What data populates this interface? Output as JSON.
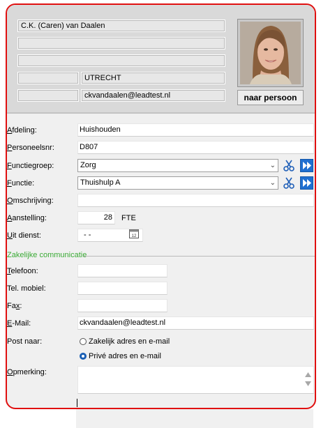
{
  "header": {
    "name": "C.K. (Caren) van Daalen",
    "line2": "",
    "line3": "",
    "postcode": "",
    "city": "UTRECHT",
    "extra": "",
    "email": "ckvandaalen@leadtest.nl",
    "person_button": "naar persoon"
  },
  "labels": {
    "afdeling": {
      "first": "A",
      "rest": "fdeling:"
    },
    "personeelsnr": {
      "first": "P",
      "rest": "ersoneelsnr:"
    },
    "functiegroep": {
      "first": "F",
      "rest": "unctiegroep:"
    },
    "functie": {
      "first": "F",
      "rest": "unctie:"
    },
    "omschrijving": {
      "first": "O",
      "rest": "mschrijving:"
    },
    "aanstelling": {
      "first": "A",
      "rest": "anstelling:"
    },
    "uitdienst": {
      "first": "U",
      "rest": "it dienst:"
    },
    "telefoon": {
      "first": "T",
      "rest": "elefoon:"
    },
    "mobiel": "Tel. mobiel:",
    "fax": {
      "first": "Fa",
      "mid": "x",
      "rest": ":"
    },
    "email": {
      "first": "E",
      "rest": "-Mail:"
    },
    "postnaar": "Post naar:",
    "opmerking": {
      "first": "O",
      "rest": "pmerking:"
    }
  },
  "fields": {
    "afdeling": "Huishouden",
    "personeelsnr": "D807",
    "functiegroep": "Zorg",
    "functie": "Thuishulp A",
    "omschrijving": "",
    "aanstelling": "28",
    "aanstelling_unit": "FTE",
    "uitdienst": "-  -",
    "telefoon": "",
    "mobiel": "",
    "fax": "",
    "email": "ckvandaalen@leadtest.nl",
    "opmerking": ""
  },
  "group": {
    "title": "Zakelijke communicatie"
  },
  "post_options": [
    {
      "label": "Zakelijk adres en e-mail",
      "selected": false
    },
    {
      "label": "Privé adres en e-mail",
      "selected": true
    }
  ],
  "colors": {
    "accent_green": "#3aaa35",
    "frame_red": "#e01010",
    "radio_blue": "#1a5fb4"
  },
  "icons": {
    "scissors": "scissors-icon",
    "forward": "fast-forward-icon",
    "calendar": "calendar-icon",
    "dropdown": "chevron-down-icon"
  }
}
